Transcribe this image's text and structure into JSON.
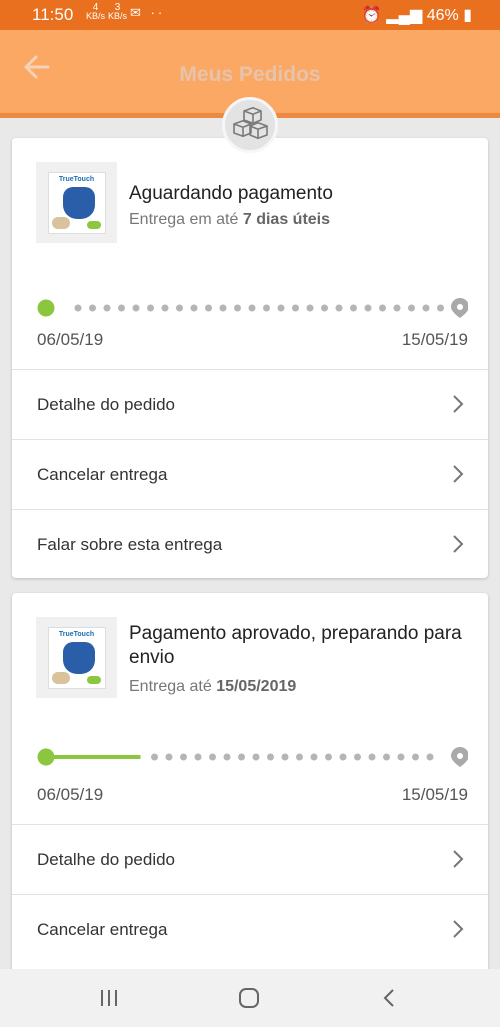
{
  "status_bar": {
    "time": "11:50",
    "net_down_value": "4",
    "net_down_unit": "KB/s",
    "net_up_value": "3",
    "net_up_unit": "KB/s",
    "battery": "46%"
  },
  "header": {
    "title": "Meus Pedidos"
  },
  "orders": [
    {
      "status": "Aguardando pagamento",
      "delivery_prefix": "Entrega em até",
      "delivery_value": "7 dias úteis",
      "start_date": "06/05/19",
      "end_date": "15/05/19",
      "progress": 0.0,
      "actions": [
        "Detalhe do pedido",
        "Cancelar entrega",
        "Falar sobre esta entrega"
      ]
    },
    {
      "status": "Pagamento aprovado, preparando para envio",
      "delivery_prefix": "Entrega até",
      "delivery_value": "15/05/2019",
      "start_date": "06/05/19",
      "end_date": "15/05/19",
      "progress": 0.25,
      "actions": [
        "Detalhe do pedido",
        "Cancelar entrega"
      ]
    }
  ],
  "product_thumb": {
    "brand": "TrueTouch"
  },
  "colors": {
    "status_bar": "#e8701e",
    "app_bar": "#fba865",
    "progress_green": "#8cc63f",
    "timeline_dots": "#b5b5b5"
  },
  "icons": [
    "back-arrow-icon",
    "boxes-icon",
    "location-pin-icon",
    "chevron-right-icon",
    "recent-apps-icon",
    "home-icon",
    "back-nav-icon"
  ]
}
